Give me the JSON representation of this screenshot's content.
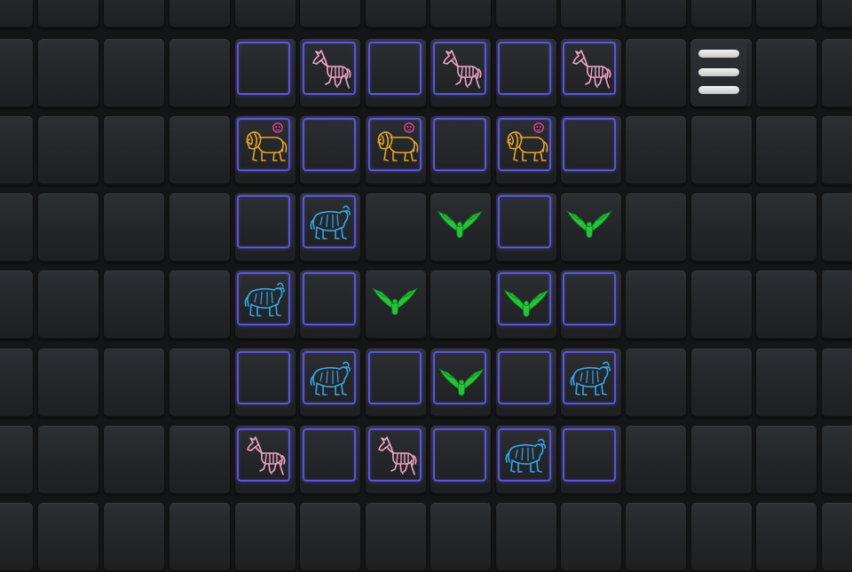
{
  "game": {
    "colors": {
      "cell_border": "#5a56d8",
      "zebra": "#f2a6c8",
      "lion": "#e6a52a",
      "buffalo": "#35a8ec",
      "bird": "#27c43a",
      "badge": "#e0409a"
    },
    "menu": {
      "icon": "hamburger-menu-icon"
    },
    "board": {
      "rows": [
        [
          {
            "lit": true,
            "piece": "empty"
          },
          {
            "lit": true,
            "piece": "zebra"
          },
          {
            "lit": true,
            "piece": "empty"
          },
          {
            "lit": true,
            "piece": "zebra"
          },
          {
            "lit": true,
            "piece": "empty"
          },
          {
            "lit": true,
            "piece": "zebra"
          }
        ],
        [
          {
            "lit": true,
            "piece": "lion",
            "badge": true
          },
          {
            "lit": true,
            "piece": "empty"
          },
          {
            "lit": true,
            "piece": "lion",
            "badge": true
          },
          {
            "lit": true,
            "piece": "empty"
          },
          {
            "lit": true,
            "piece": "lion",
            "badge": true
          },
          {
            "lit": true,
            "piece": "empty"
          }
        ],
        [
          {
            "lit": true,
            "piece": "empty"
          },
          {
            "lit": true,
            "piece": "buffalo"
          },
          {
            "lit": false,
            "piece": "empty"
          },
          {
            "lit": false,
            "piece": "bird"
          },
          {
            "lit": true,
            "piece": "empty"
          },
          {
            "lit": false,
            "piece": "bird"
          }
        ],
        [
          {
            "lit": true,
            "piece": "buffalo"
          },
          {
            "lit": true,
            "piece": "empty"
          },
          {
            "lit": false,
            "piece": "bird"
          },
          {
            "lit": false,
            "piece": "empty"
          },
          {
            "lit": true,
            "piece": "bird"
          },
          {
            "lit": true,
            "piece": "empty"
          }
        ],
        [
          {
            "lit": true,
            "piece": "empty"
          },
          {
            "lit": true,
            "piece": "buffalo"
          },
          {
            "lit": true,
            "piece": "empty"
          },
          {
            "lit": true,
            "piece": "bird"
          },
          {
            "lit": true,
            "piece": "empty"
          },
          {
            "lit": true,
            "piece": "buffalo"
          }
        ],
        [
          {
            "lit": true,
            "piece": "zebra"
          },
          {
            "lit": true,
            "piece": "empty"
          },
          {
            "lit": true,
            "piece": "zebra"
          },
          {
            "lit": true,
            "piece": "empty"
          },
          {
            "lit": true,
            "piece": "buffalo"
          },
          {
            "lit": true,
            "piece": "empty"
          }
        ]
      ]
    }
  }
}
